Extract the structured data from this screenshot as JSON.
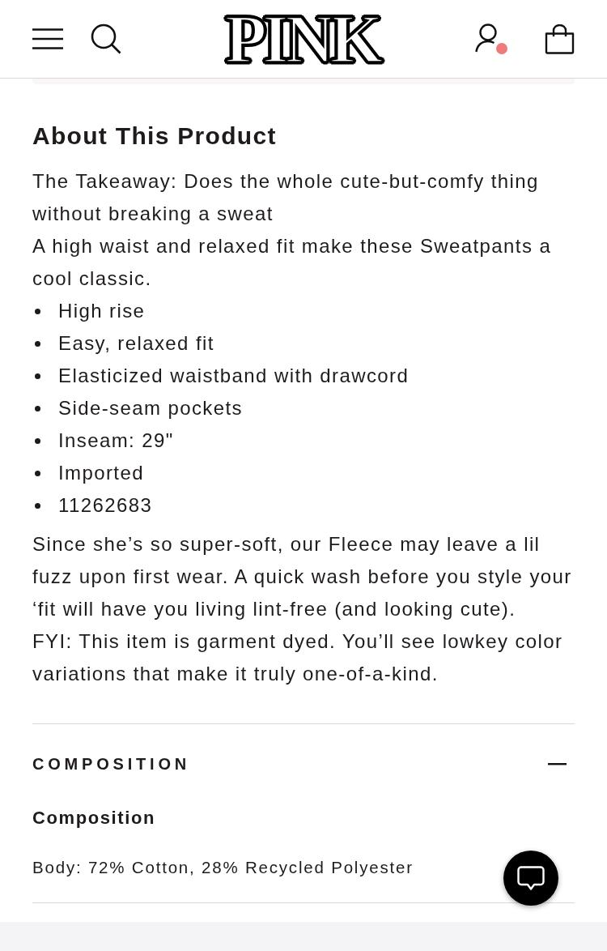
{
  "header": {
    "logo": "PINK",
    "account_notification": true
  },
  "about": {
    "title": "About This Product",
    "intro": [
      "The Takeaway: Does the whole cute-but-comfy thing without breaking a sweat",
      "A high waist and relaxed fit make these Sweatpants a cool classic."
    ],
    "features": [
      "High rise",
      "Easy, relaxed fit",
      "Elasticized waistband with drawcord",
      "Side-seam pockets",
      "Inseam: 29\"",
      "Imported",
      "11262683"
    ],
    "notes": [
      "Since she’s so super-soft, our Fleece may leave a lil fuzz upon first wear. A quick wash before you style your ‘fit will have you living lint-free (and looking cute).",
      "FYI: This item is garment dyed. You’ll see lowkey color variations that make it truly one-of-a-kind."
    ]
  },
  "accordion": {
    "title": "COMPOSITION",
    "expanded": true,
    "subtitle": "Composition",
    "text": "Body: 72% Cotton, 28% Recycled Polyester"
  }
}
